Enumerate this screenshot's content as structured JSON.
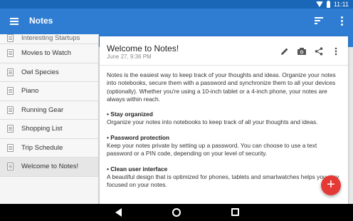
{
  "status": {
    "time": "11:11"
  },
  "appbar": {
    "title": "Notes"
  },
  "list": {
    "items": [
      {
        "label": "Interesting Startups",
        "partial": true
      },
      {
        "label": "Movies to Watch"
      },
      {
        "label": "Owl Species"
      },
      {
        "label": "Piano"
      },
      {
        "label": "Running Gear"
      },
      {
        "label": "Shopping List"
      },
      {
        "label": "Trip Schedule"
      },
      {
        "label": "Welcome to Notes!",
        "selected": true
      }
    ]
  },
  "note": {
    "title": "Welcome to Notes!",
    "date": "June 27, 9:36 PM",
    "intro": "Notes is the easiest way to keep track of your thoughts and ideas. Organize your notes into notebooks, secure them with a password and synchronize them to all your devices (optionally). Whether you're using a 10-inch tablet or a 4-inch phone, your notes are always within reach.",
    "sections": [
      {
        "heading": "• Stay organized",
        "text": "Organize your notes into notebooks to keep track of all your thoughts and ideas."
      },
      {
        "heading": "• Password protection",
        "text": "Keep your notes private by setting up a password. You can choose to use a text password or a PIN code, depending on your level of security."
      },
      {
        "heading": "• Clean user interface",
        "text": "A beautiful design that is optimized for phones, tablets and smartwatches helps you stay focused on your notes."
      }
    ]
  },
  "icons": {
    "menu": "menu-icon",
    "sort": "sort-icon",
    "overflow": "overflow-menu-icon",
    "edit": "pencil-icon",
    "camera": "camera-icon",
    "share": "share-icon",
    "fab": "plus-icon"
  },
  "fab": {
    "label": "+"
  },
  "colors": {
    "primary": "#2f7dd3",
    "statusbar": "#1a67b8",
    "accent": "#e53935"
  }
}
